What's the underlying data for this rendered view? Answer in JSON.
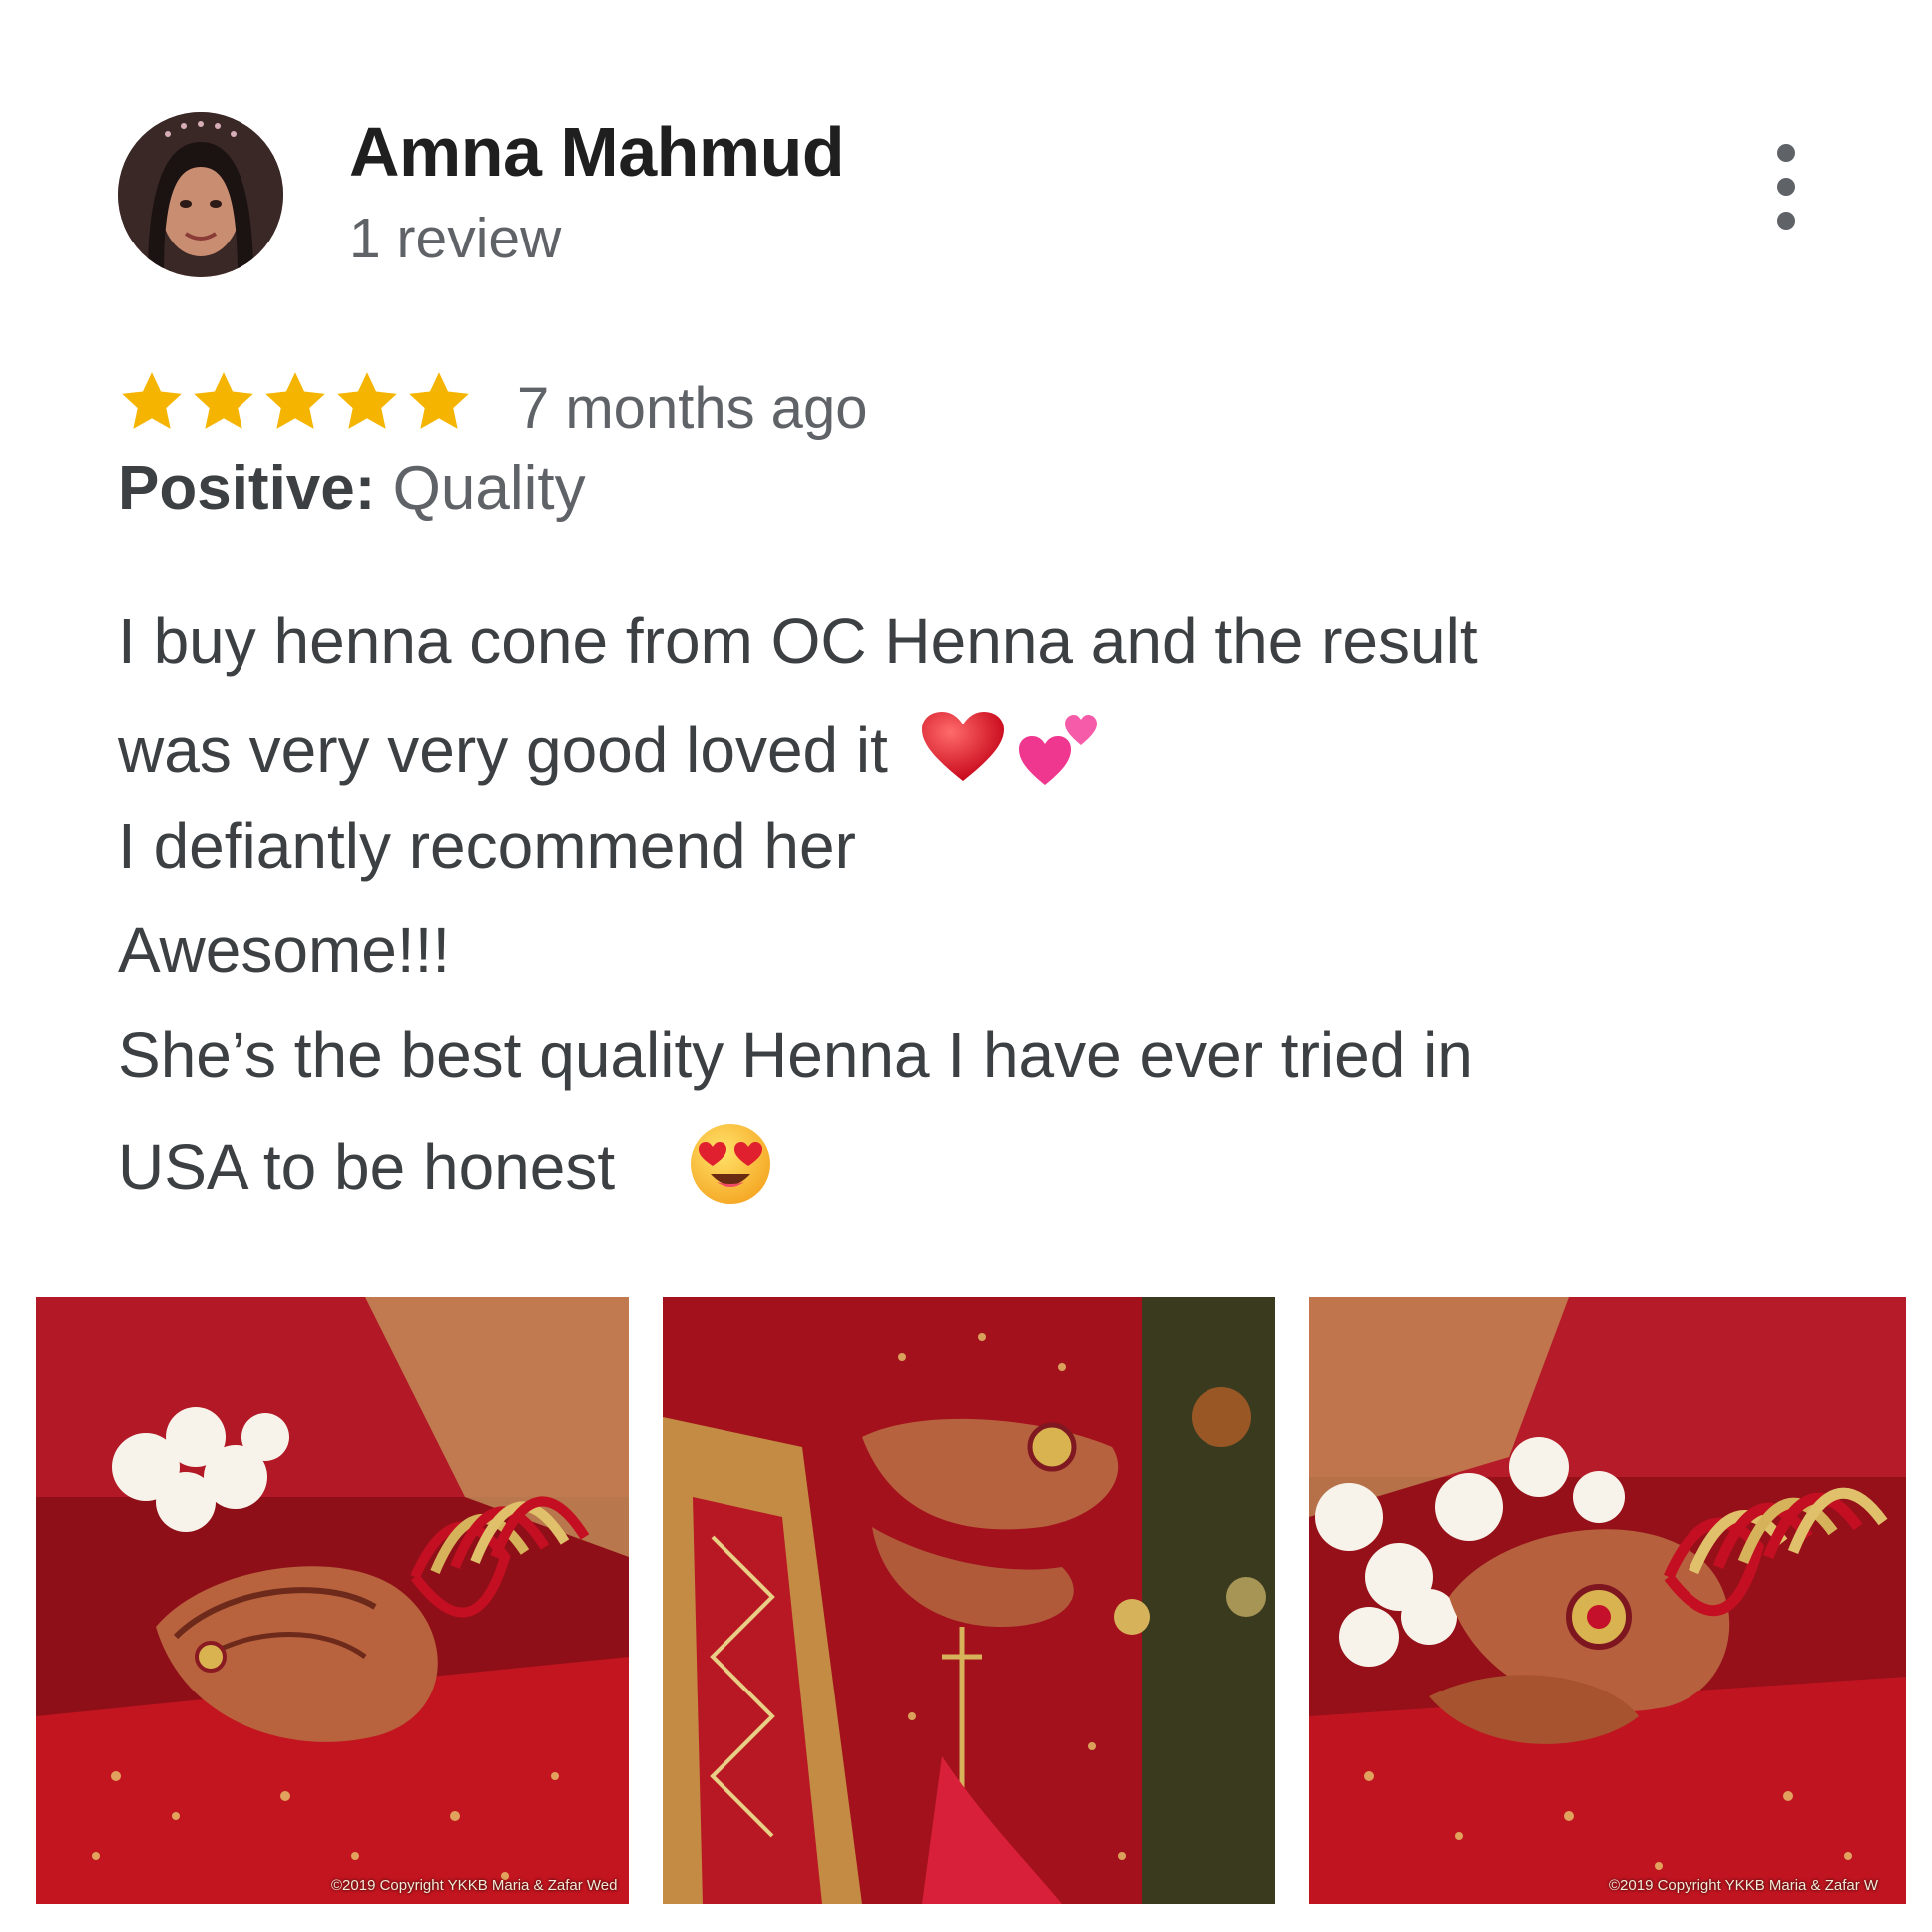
{
  "reviewer": {
    "name": "Amna Mahmud",
    "review_count": "1 review"
  },
  "rating": {
    "stars": 5,
    "max_stars": 5,
    "star_color": "#f4b400",
    "time_ago": "7 months ago"
  },
  "highlight": {
    "label": "Positive:",
    "value": "Quality"
  },
  "review_text": {
    "line1": "I buy henna cone from OC Henna and the result",
    "line2": "was very very good loved it",
    "line3": "I defiantly recommend her",
    "line4": "Awesome!!!",
    "line5": "She’s the best quality Henna I have ever tried in",
    "line6": "USA to be honest"
  },
  "emojis": {
    "line2": [
      "red-heart-emoji",
      "two-hearts-emoji"
    ],
    "line6": [
      "heart-eyes-emoji"
    ]
  },
  "photos": [
    {
      "caption": "©2019 Copyright YKKB   Maria & Zafar Wed"
    },
    {
      "caption": ""
    },
    {
      "caption": "©2019 Copyright YKKB   Maria & Zafar W"
    }
  ],
  "colors": {
    "name": "#1f1f1f",
    "secondary_text": "#5f6368",
    "body_text": "#3c4043",
    "bridal_red": "#b3121c",
    "gold": "#c9a14a"
  }
}
